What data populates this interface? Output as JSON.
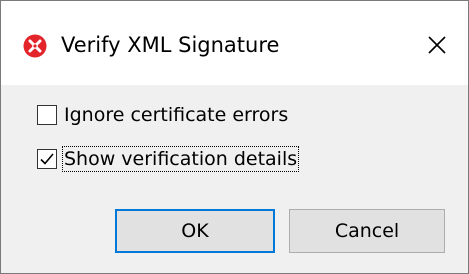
{
  "window": {
    "title": "Verify XML Signature",
    "icon": "xml-signature-app-icon",
    "close_icon": "close-icon"
  },
  "options": [
    {
      "label": "Ignore certificate errors",
      "checked": false
    },
    {
      "label": "Show verification details",
      "checked": true
    }
  ],
  "buttons": {
    "ok_label": "OK",
    "cancel_label": "Cancel"
  },
  "colors": {
    "icon_red": "#e3242b",
    "default_button_border": "#0078d7",
    "button_bg": "#e1e1e1",
    "dialog_bg": "#f0f0f0"
  }
}
